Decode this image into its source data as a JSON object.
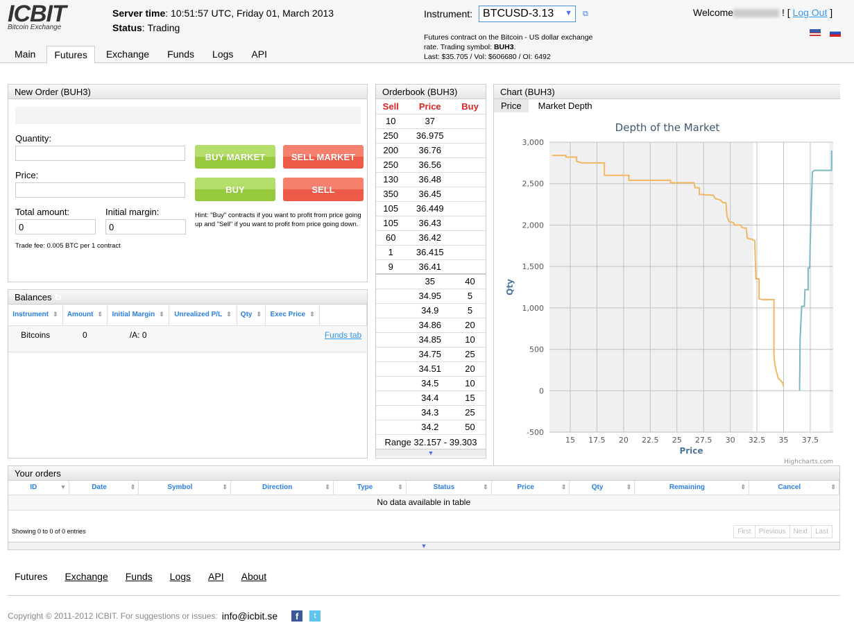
{
  "logo": {
    "title": "ICBIT",
    "subtitle": "Bitcoin Exchange"
  },
  "header": {
    "server_time_label": "Server time",
    "server_time": ": 10:51:57 UTC, Friday 01, March 2013",
    "status_label": "Status",
    "status": ": Trading",
    "instrument_label": "Instrument:",
    "instrument": "BTCUSD-3.13",
    "desc_line1": "Futures contract on the Bitcoin - US dollar exchange",
    "desc_line2": "rate. Trading symbol: ",
    "symbol": "BUH3",
    "desc_line3": "Last: $35.705 / Vol: $606680 / OI: 6492",
    "welcome": "Welcome",
    "welcome_suffix": " ! [ ",
    "logout": "Log Out",
    "bracket_close": " ]"
  },
  "tabs": [
    "Main",
    "Futures",
    "Exchange",
    "Funds",
    "Logs",
    "API"
  ],
  "new_order": {
    "title": "New Order (BUH3)",
    "quantity_label": "Quantity:",
    "quantity": "",
    "price_label": "Price:",
    "price": "",
    "total_label": "Total amount:",
    "total": "0",
    "margin_label": "Initial margin:",
    "margin": "0",
    "fee": "Trade fee: 0.005 BTC per 1 contract",
    "buy_market": "BUY MARKET",
    "sell_market": "SELL MARKET",
    "buy": "BUY",
    "sell": "SELL",
    "hint": "Hint: \"Buy\" contracts if you want to profit from price going up and \"Sell\" if you want to profit from price going down."
  },
  "balances": {
    "title": "Balances",
    "columns": [
      "Instrument",
      "Amount",
      "Initial Margin",
      "Unrealized P/L",
      "Qty",
      "Exec Price"
    ],
    "rows": [
      {
        "instrument": "Bitcoins",
        "amount": "0",
        "margin": "/A: 0",
        "link": "Funds tab"
      }
    ]
  },
  "orderbook": {
    "title": "Orderbook (BUH3)",
    "headers": [
      "Sell",
      "Price",
      "Buy"
    ],
    "rows": [
      [
        "10",
        "37",
        ""
      ],
      [
        "250",
        "36.975",
        ""
      ],
      [
        "200",
        "36.76",
        ""
      ],
      [
        "250",
        "36.56",
        ""
      ],
      [
        "130",
        "36.48",
        ""
      ],
      [
        "350",
        "36.45",
        ""
      ],
      [
        "105",
        "36.449",
        ""
      ],
      [
        "105",
        "36.43",
        ""
      ],
      [
        "60",
        "36.42",
        ""
      ],
      [
        "1",
        "36.415",
        ""
      ],
      [
        "9",
        "36.41",
        ""
      ],
      [
        "",
        "35",
        "40"
      ],
      [
        "",
        "34.95",
        "5"
      ],
      [
        "",
        "34.9",
        "5"
      ],
      [
        "",
        "34.86",
        "20"
      ],
      [
        "",
        "34.85",
        "10"
      ],
      [
        "",
        "34.75",
        "25"
      ],
      [
        "",
        "34.51",
        "20"
      ],
      [
        "",
        "34.5",
        "10"
      ],
      [
        "",
        "34.4",
        "15"
      ],
      [
        "",
        "34.3",
        "25"
      ],
      [
        "",
        "34.2",
        "50"
      ]
    ],
    "range": "Range 32.157 - 39.303"
  },
  "chart_panel": {
    "title": "Chart (BUH3)",
    "tabs": [
      "Price",
      "Market Depth"
    ],
    "credit": "Highcharts.com"
  },
  "chart_data": {
    "type": "line",
    "title": "Depth of the Market",
    "xlabel": "Price",
    "ylabel": "Qty",
    "xlim": [
      13.05,
      39.65
    ],
    "ylim": [
      -500,
      3000
    ],
    "xticks": [
      15,
      17.5,
      20,
      22.5,
      25,
      27.5,
      30,
      32.5,
      35,
      37.5
    ],
    "yticks": [
      -500,
      0,
      500,
      1000,
      1500,
      2000,
      2500,
      3000
    ],
    "shaded_outside": [
      32.157,
      39.303
    ],
    "series": [
      {
        "name": "Bids",
        "color": "#f0b860",
        "points": [
          [
            13.3,
            2840
          ],
          [
            14.6,
            2840
          ],
          [
            14.6,
            2820
          ],
          [
            15.6,
            2820
          ],
          [
            15.6,
            2770
          ],
          [
            16.1,
            2750
          ],
          [
            18.2,
            2750
          ],
          [
            18.2,
            2600
          ],
          [
            20.5,
            2600
          ],
          [
            20.5,
            2540
          ],
          [
            24.4,
            2540
          ],
          [
            24.4,
            2510
          ],
          [
            26.6,
            2510
          ],
          [
            26.7,
            2450
          ],
          [
            27.1,
            2450
          ],
          [
            27.1,
            2370
          ],
          [
            28.4,
            2360
          ],
          [
            28.6,
            2320
          ],
          [
            29.1,
            2300
          ],
          [
            29.3,
            2270
          ],
          [
            29.6,
            2270
          ],
          [
            29.7,
            2100
          ],
          [
            29.9,
            2040
          ],
          [
            30.3,
            2030
          ],
          [
            30.4,
            2000
          ],
          [
            31.0,
            2000
          ],
          [
            31.1,
            1970
          ],
          [
            31.5,
            1960
          ],
          [
            31.6,
            1840
          ],
          [
            32.0,
            1830
          ],
          [
            32.3,
            1810
          ],
          [
            32.4,
            1350
          ],
          [
            32.7,
            1350
          ],
          [
            32.7,
            1110
          ],
          [
            33.0,
            1100
          ],
          [
            34.1,
            1100
          ],
          [
            34.1,
            430
          ],
          [
            34.2,
            300
          ],
          [
            34.4,
            200
          ],
          [
            34.5,
            150
          ],
          [
            34.9,
            100
          ],
          [
            35.0,
            50
          ]
        ]
      },
      {
        "name": "Asks",
        "color": "#7bb8c4",
        "points": [
          [
            36.5,
            0
          ],
          [
            36.55,
            640
          ],
          [
            36.6,
            760
          ],
          [
            36.7,
            1020
          ],
          [
            36.95,
            1020
          ],
          [
            37.0,
            1220
          ],
          [
            37.3,
            1220
          ],
          [
            37.3,
            1480
          ],
          [
            37.45,
            1480
          ],
          [
            37.5,
            1800
          ],
          [
            37.6,
            2240
          ],
          [
            37.7,
            2640
          ],
          [
            37.9,
            2660
          ],
          [
            39.5,
            2660
          ],
          [
            39.5,
            2900
          ]
        ]
      }
    ]
  },
  "orders": {
    "title": "Your orders",
    "columns": [
      "ID",
      "Date",
      "Symbol",
      "Direction",
      "Type",
      "Status",
      "Price",
      "Qty",
      "Remaining",
      "Cancel"
    ],
    "empty": "No data available in table",
    "info": "Showing 0 to 0 of 0 entries",
    "pager": [
      "First",
      "Previous",
      "Next",
      "Last"
    ]
  },
  "footer": {
    "links": [
      "Futures",
      "Exchange",
      "Funds",
      "Logs",
      "API",
      "About"
    ],
    "copyright": "Copyright © 2011-2012 ICBIT. For suggestions or issues:",
    "email": "info@icbit.se"
  }
}
